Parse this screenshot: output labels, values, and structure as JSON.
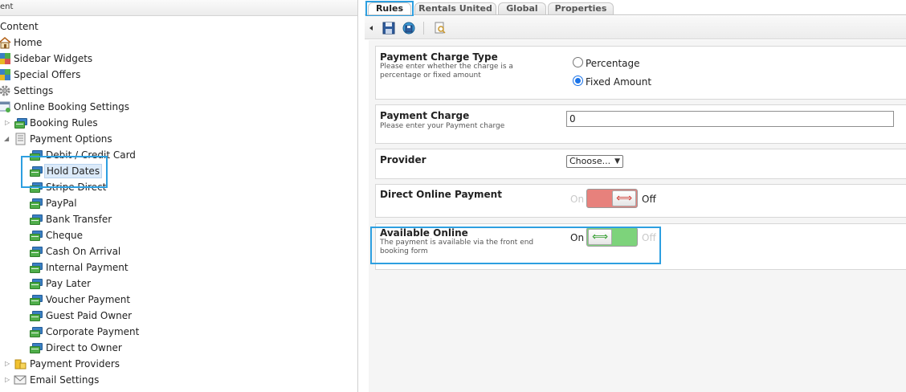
{
  "tree": {
    "header": "ent",
    "items": [
      {
        "label": "Content"
      },
      {
        "label": "Home"
      },
      {
        "label": "Sidebar Widgets"
      },
      {
        "label": "Special Offers"
      },
      {
        "label": "Settings"
      },
      {
        "label": "Online Booking Settings"
      },
      {
        "label": "Booking Rules"
      },
      {
        "label": "Payment Options"
      },
      {
        "label": "Debit / Credit Card"
      },
      {
        "label": "Hold Dates"
      },
      {
        "label": "Stripe Direct"
      },
      {
        "label": "PayPal"
      },
      {
        "label": "Bank Transfer"
      },
      {
        "label": "Cheque"
      },
      {
        "label": "Cash On Arrival"
      },
      {
        "label": "Internal Payment"
      },
      {
        "label": "Pay Later"
      },
      {
        "label": "Voucher Payment"
      },
      {
        "label": "Guest Paid Owner"
      },
      {
        "label": "Corporate Payment"
      },
      {
        "label": "Direct to Owner"
      },
      {
        "label": "Payment Providers"
      },
      {
        "label": "Email Settings"
      }
    ]
  },
  "tabs": [
    {
      "label": "Rules"
    },
    {
      "label": "Rentals United"
    },
    {
      "label": "Global"
    },
    {
      "label": "Properties"
    }
  ],
  "toolbar": {
    "icons": [
      "collapse-arrow-icon",
      "save-icon",
      "save-and-publish-icon",
      "preview-icon"
    ]
  },
  "form": {
    "charge_type": {
      "label": "Payment Charge Type",
      "help": "Please enter whether the charge is a percentage or fixed amount",
      "options": [
        "Percentage",
        "Fixed Amount"
      ],
      "selected": "Fixed Amount"
    },
    "charge": {
      "label": "Payment Charge",
      "help": "Please enter your Payment charge",
      "value": "0"
    },
    "provider": {
      "label": "Provider",
      "selected": "Choose..."
    },
    "direct_online": {
      "label": "Direct Online Payment",
      "on_text": "On",
      "off_text": "Off",
      "state": "off"
    },
    "available_online": {
      "label": "Available Online",
      "help": "The payment is available via the front end booking form",
      "on_text": "On",
      "off_text": "Off",
      "state": "on"
    }
  },
  "colors": {
    "highlight": "#2d9fe0",
    "toggle_on": "#7dd37b",
    "toggle_off": "#e7817c",
    "selected_item": "#dbeaf9"
  }
}
